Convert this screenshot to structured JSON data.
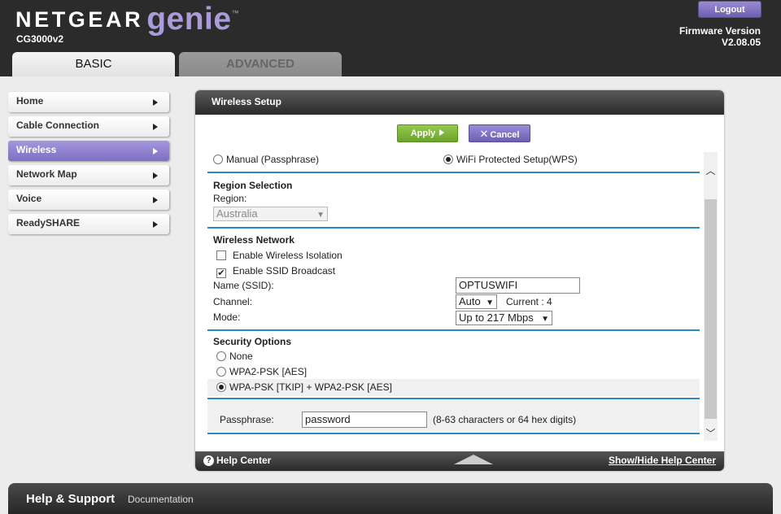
{
  "header": {
    "brand": "NETGEAR",
    "product": "genie",
    "trademark": "™",
    "model": "CG3000v2",
    "logout_label": "Logout",
    "firmware_label": "Firmware Version",
    "firmware_value": "V2.08.05"
  },
  "tabs": [
    {
      "label": "BASIC",
      "active": true
    },
    {
      "label": "ADVANCED",
      "active": false
    }
  ],
  "menu": [
    {
      "label": "Home",
      "active": false
    },
    {
      "label": "Cable Connection",
      "active": false
    },
    {
      "label": "Wireless",
      "active": true
    },
    {
      "label": "Network Map",
      "active": false
    },
    {
      "label": "Voice",
      "active": false
    },
    {
      "label": "ReadySHARE",
      "active": false
    }
  ],
  "panel": {
    "title": "Wireless Setup",
    "apply_label": "Apply",
    "cancel_label": "Cancel",
    "setup_mode": {
      "manual": "Manual (Passphrase)",
      "wps": "WiFi Protected Setup(WPS)",
      "selected": "wps"
    },
    "region": {
      "title": "Region Selection",
      "label": "Region:",
      "value": "Australia"
    },
    "wireless_network": {
      "title": "Wireless Network",
      "isolation_label": "Enable Wireless Isolation",
      "isolation_checked": false,
      "ssid_broadcast_label": "Enable SSID Broadcast",
      "ssid_broadcast_checked": true,
      "ssid_label": "Name (SSID):",
      "ssid_value": "OPTUSWIFI",
      "channel_label": "Channel:",
      "channel_value": "Auto",
      "current_channel": "Current : 4",
      "mode_label": "Mode:",
      "mode_value": "Up to 217 Mbps"
    },
    "security": {
      "title": "Security Options",
      "none": "None",
      "wpa2": "WPA2-PSK [AES]",
      "wpa_mixed": "WPA-PSK [TKIP] + WPA2-PSK [AES]",
      "selected": "wpa_mixed",
      "passphrase_label": "Passphrase:",
      "passphrase_value": "password",
      "passphrase_hint": "(8-63 characters or 64 hex digits)"
    },
    "help_center": "Help Center",
    "help_toggle": "Show/Hide Help Center"
  },
  "footer": {
    "title": "Help & Support",
    "documentation": "Documentation"
  },
  "colors": {
    "accent_purple": "#8a7bcc",
    "apply_green": "#7cb53a",
    "divider_blue": "#2c8ac0",
    "header_dark": "#2b2b2b"
  }
}
